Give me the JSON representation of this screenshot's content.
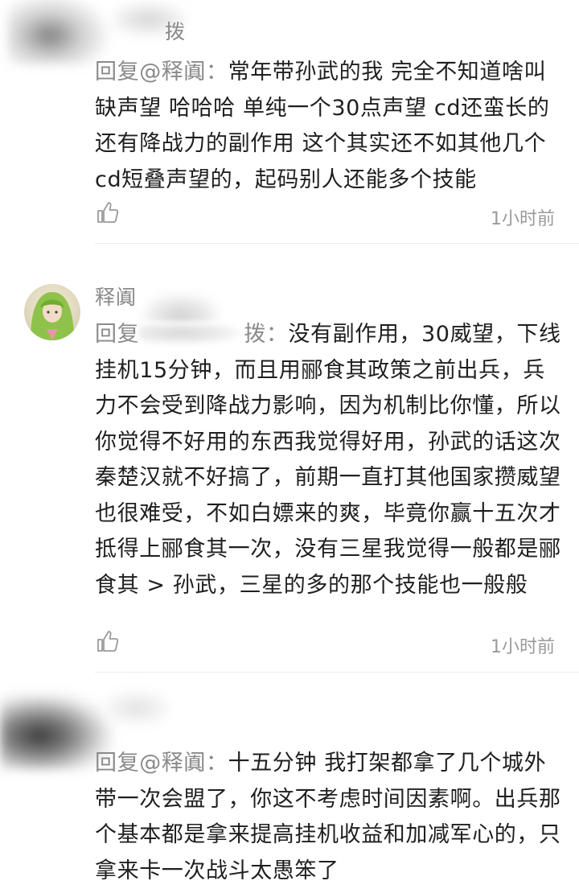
{
  "comments": [
    {
      "username": "拨",
      "reply_prefix": "回复@释阗：",
      "text": "常年带孙武的我 完全不知道啥叫缺声望 哈哈哈 单纯一个30点声望 cd还蛮长的 还有降战力的副作用 这个其实还不如其他几个cd短叠声望的，起码别人还能多个技能",
      "time": "1小时前"
    },
    {
      "username": "释阗",
      "reply_prefix": "回复",
      "reply_target_visible": "拨",
      "colon": "：",
      "text": "没有副作用，30威望，下线挂机15分钟，而且用郦食其政策之前出兵，兵力不会受到降战力影响，因为机制比你懂，所以你觉得不好用的东西我觉得好用，孙武的话这次秦楚汉就不好搞了，前期一直打其他国家攒威望也很难受，不如白嫖来的爽，毕竟你赢十五次才抵得上郦食其一次，没有三星我觉得一般都是郦食其 > 孙武，三星的多的那个技能也一般般",
      "time": "1小时前"
    },
    {
      "username": "",
      "reply_prefix": "回复@释阗：",
      "text": "十五分钟 我打架都拿了几个城外带一次会盟了，你这不考虑时间因素啊。出兵那个基本都是拿来提高挂机收益和加减军心的，只拿来卡一次战斗太愚笨了"
    }
  ],
  "icons": {
    "like": "thumbs-up-icon"
  },
  "colors": {
    "secondary_text": "#8a8a8a",
    "body_text": "#1f1f1f",
    "divider": "#ececec"
  }
}
